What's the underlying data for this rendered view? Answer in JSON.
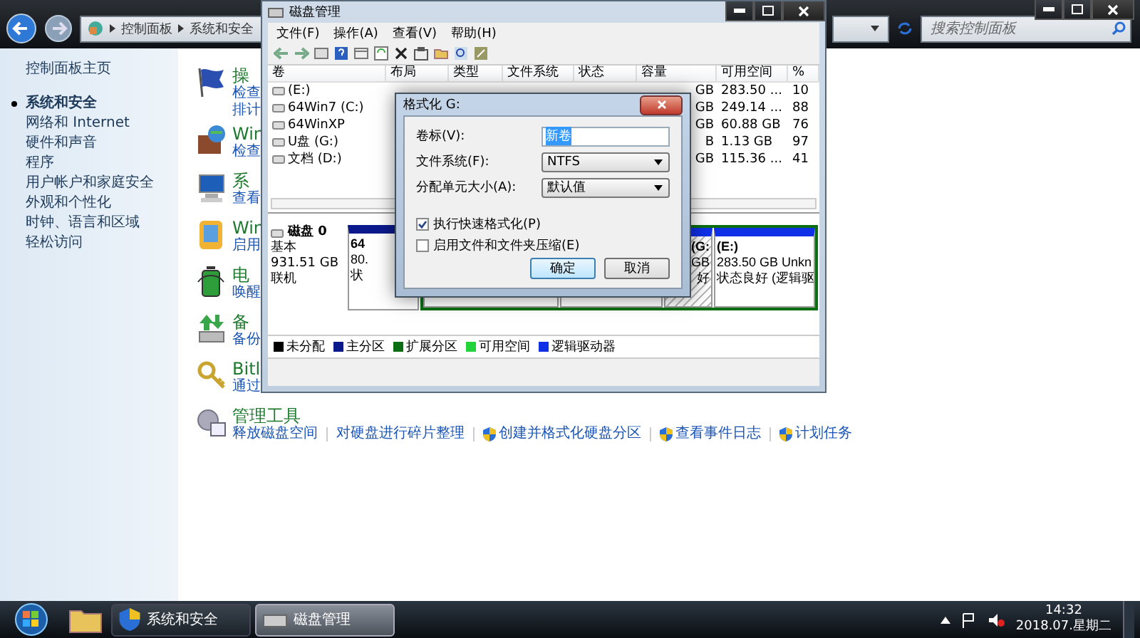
{
  "explorer": {
    "breadcrumb": [
      "控制面板",
      "系统和安全"
    ],
    "search": {
      "placeholder": "搜索控制面板"
    }
  },
  "nav": [
    {
      "label": "控制面板主页",
      "selected": false
    },
    {
      "label": "系统和安全",
      "selected": true
    },
    {
      "label": "网络和 Internet",
      "selected": false
    },
    {
      "label": "硬件和声音",
      "selected": false
    },
    {
      "label": "程序",
      "selected": false
    },
    {
      "label": "用户帐户和家庭安全",
      "selected": false
    },
    {
      "label": "外观和个性化",
      "selected": false
    },
    {
      "label": "时钟、语言和区域",
      "selected": false
    },
    {
      "label": "轻松访问",
      "selected": false
    }
  ],
  "categories": [
    {
      "kind": "flag",
      "title": "操",
      "links": [
        "检查",
        "排计"
      ]
    },
    {
      "kind": "firewall",
      "title": "Win",
      "links": [
        "检查"
      ]
    },
    {
      "kind": "system",
      "title": "系",
      "links": [
        "查看"
      ]
    },
    {
      "kind": "update",
      "title": "Win",
      "links": [
        "启用"
      ]
    },
    {
      "kind": "power",
      "title": "电",
      "links": [
        "唤醒"
      ]
    },
    {
      "kind": "backup",
      "title": "备",
      "links": [
        "备份"
      ]
    },
    {
      "kind": "bitlocker",
      "title": "Bitl",
      "links": [
        "通过"
      ]
    }
  ],
  "admin_tools": {
    "title": "管理工具",
    "links": [
      {
        "text": "释放磁盘空间",
        "shield": false
      },
      {
        "text": "对硬盘进行碎片整理",
        "shield": false
      },
      {
        "text": "创建并格式化硬盘分区",
        "shield": true
      },
      {
        "text": "查看事件日志",
        "shield": true
      },
      {
        "text": "计划任务",
        "shield": true
      }
    ]
  },
  "disk_manager": {
    "title": "磁盘管理",
    "menu": [
      "文件(F)",
      "操作(A)",
      "查看(V)",
      "帮助(H)"
    ],
    "columns": [
      "卷",
      "布局",
      "类型",
      "文件系统",
      "状态",
      "容量",
      "可用空间",
      "%"
    ],
    "rows": [
      {
        "volume": "(E:)",
        "capacity": "GB",
        "free": "283.50 ...",
        "percent": "10"
      },
      {
        "volume": "64Win7  (C:)",
        "capacity": "GB",
        "free": "249.14 ...",
        "percent": "88"
      },
      {
        "volume": "64WinXP",
        "capacity": "GB",
        "free": "60.88 GB",
        "percent": "76"
      },
      {
        "volume": "U盘 (G:)",
        "capacity": "B",
        "free": "1.13 GB",
        "percent": "97"
      },
      {
        "volume": "文档 (D:)",
        "capacity": "GB",
        "free": "115.36 ...",
        "percent": "41"
      }
    ],
    "disk": {
      "name": "磁盘 0",
      "type": "基本",
      "size": "931.51 GB",
      "status": "联机"
    },
    "partitions": [
      {
        "kind": "primary",
        "selected": false,
        "lines": [
          "64",
          "80.",
          "状"
        ]
      },
      {
        "kind": "logical",
        "selected": false
      },
      {
        "kind": "logical",
        "selected": false
      },
      {
        "kind": "logical",
        "selected": true,
        "lines": [
          "(G:",
          "GB",
          "好"
        ]
      },
      {
        "kind": "logical",
        "selected": false,
        "lines": [
          "(E:)",
          "283.50 GB Unkn",
          "状态良好 (逻辑驱"
        ]
      }
    ],
    "legend": [
      {
        "label": "未分配",
        "color": "#000000"
      },
      {
        "label": "主分区",
        "color": "#0a1a8c"
      },
      {
        "label": "扩展分区",
        "color": "#0b6e12"
      },
      {
        "label": "可用空间",
        "color": "#22d43a"
      },
      {
        "label": "逻辑驱动器",
        "color": "#1030e8"
      }
    ]
  },
  "format_dialog": {
    "title": "格式化 G:",
    "fields": [
      {
        "kind": "text",
        "label": "卷标(V):",
        "value": "新卷"
      },
      {
        "kind": "select",
        "label": "文件系统(F):",
        "value": "NTFS"
      },
      {
        "kind": "select",
        "label": "分配单元大小(A):",
        "value": "默认值"
      }
    ],
    "options": [
      {
        "label": "执行快速格式化(P)",
        "checked": true
      },
      {
        "label": "启用文件和文件夹压缩(E)",
        "checked": false
      }
    ],
    "buttons": [
      {
        "label": "确定",
        "default": true
      },
      {
        "label": "取消",
        "default": false
      }
    ]
  },
  "taskbar": {
    "tasks": [
      {
        "kind": "control-panel",
        "label": "系统和安全",
        "selected": false
      },
      {
        "kind": "disk",
        "label": "磁盘管理",
        "selected": true
      }
    ],
    "time": "14:32",
    "date": "2018.07.星期二"
  }
}
